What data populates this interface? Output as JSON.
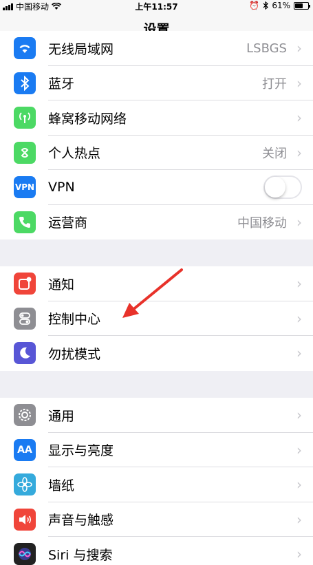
{
  "status": {
    "carrier": "中国移动",
    "time": "上午11:57",
    "battery": "61%",
    "battery_level": 0.61
  },
  "nav": {
    "title": "设置"
  },
  "group1": [
    {
      "label": "无线局域网",
      "value": "LSBGS",
      "icon": "wifi-icon",
      "color": "#1a7bf2"
    },
    {
      "label": "蓝牙",
      "value": "打开",
      "icon": "bluetooth-icon",
      "color": "#1a7bf2"
    },
    {
      "label": "蜂窝移动网络",
      "value": "",
      "icon": "cellular-icon",
      "color": "#4cd964"
    },
    {
      "label": "个人热点",
      "value": "关闭",
      "icon": "hotspot-icon",
      "color": "#4cd964"
    },
    {
      "label": "VPN",
      "value": "",
      "icon": "vpn-icon",
      "color": "#1a7bf2",
      "icon_text": "VPN",
      "toggle_on": false
    },
    {
      "label": "运营商",
      "value": "中国移动",
      "icon": "phone-icon",
      "color": "#4cd964"
    }
  ],
  "group2": [
    {
      "label": "通知",
      "icon": "notifications-icon",
      "color": "#f0453a"
    },
    {
      "label": "控制中心",
      "icon": "control-center-icon",
      "color": "#8e8e93"
    },
    {
      "label": "勿扰模式",
      "icon": "moon-icon",
      "color": "#5856d6"
    }
  ],
  "group3": [
    {
      "label": "通用",
      "icon": "gear-icon",
      "color": "#8e8e93"
    },
    {
      "label": "显示与亮度",
      "icon": "display-icon",
      "color": "#1a7bf2",
      "icon_text": "AA"
    },
    {
      "label": "墙纸",
      "icon": "wallpaper-icon",
      "color": "#35aadc"
    },
    {
      "label": "声音与触感",
      "icon": "sound-icon",
      "color": "#f0453a"
    },
    {
      "label": "Siri 与搜索",
      "icon": "siri-icon",
      "color": "#222222"
    }
  ]
}
